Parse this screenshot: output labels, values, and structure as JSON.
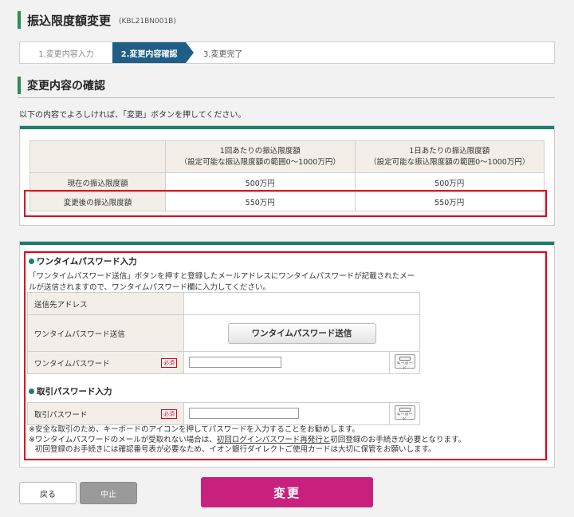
{
  "page": {
    "title": "振込限度額変更",
    "screen_id": "(KBL21BN001B)"
  },
  "steps": [
    {
      "label": "1.変更内容入力"
    },
    {
      "label": "2.変更内容確認"
    },
    {
      "label": "3.変更完了"
    }
  ],
  "section": {
    "title": "変更内容の確認",
    "instruction": "以下の内容でよろしければ、「変更」ボタンを押してください。"
  },
  "limit_table": {
    "headers": [
      "",
      "1回あたりの振込限度額\n（設定可能な振込限度額の範囲0～1000万円）",
      "1日あたりの振込限度額\n（設定可能な振込限度額の範囲0～1000万円）"
    ],
    "rows": [
      {
        "label": "現在の振込限度額",
        "per_transaction": "500万円",
        "per_day": "500万円"
      },
      {
        "label": "変更後の振込限度額",
        "per_transaction": "550万円",
        "per_day": "550万円"
      }
    ]
  },
  "otp": {
    "heading": "ワンタイムパスワード入力",
    "description": "「ワンタイムパスワード送信」ボタンを押すと登録したメールアドレスにワンタイムパスワードが記載されたメールが送信されますので、ワンタイムパスワード欄に入力してください。",
    "address_label": "送信先アドレス",
    "address_value": "",
    "send_label": "ワンタイムパスワード送信",
    "send_button": "ワンタイムパスワード送信",
    "password_label": "ワンタイムパスワード",
    "required_badge": "必須",
    "keyboard_label": "キーボード"
  },
  "txn_password": {
    "heading": "取引パスワード入力",
    "label": "取引パスワード",
    "required_badge": "必須",
    "keyboard_label": "キーボード"
  },
  "notes": {
    "note1": "※安全な取引のため、キーボードのアイコンを押してパスワードを入力することをお勧めします。",
    "note2_pre": "※ワンタイムパスワードのメールが受取れない場合は、",
    "note2_link": "初回ログインパスワード再発行と",
    "note2_post": "初回登録のお手続きが必要となります。",
    "note3": "初回登録のお手続きには確認番号表が必要なため、イオン銀行ダイレクトご使用カードは大切に保管をお願いします。"
  },
  "buttons": {
    "back": "戻る",
    "stop": "中止",
    "change": "変更"
  },
  "colors": {
    "accent_green": "#1a7f6e",
    "step_active": "#1f5e86",
    "primary_button": "#c8217d",
    "highlight_border": "#e0001a"
  }
}
